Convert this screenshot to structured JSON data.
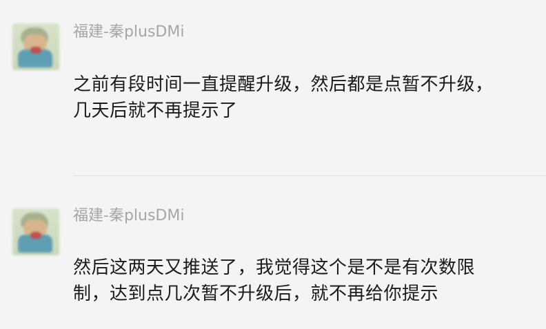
{
  "comments": [
    {
      "author": "福建-秦plusDMi",
      "text": "之前有段时间一直提醒升级，然后都是点暂不升级，几天后就不再提示了"
    },
    {
      "author": "福建-秦plusDMi",
      "text": "然后这两天又推送了，我觉得这个是不是有次数限制，达到点几次暂不升级后，就不再给你提示"
    }
  ],
  "icons": {
    "avatar": "user-avatar-icon"
  },
  "colors": {
    "background": "#f4f4f4",
    "author": "#a6a6a6",
    "text": "#1a1a1a",
    "divider": "#e3e3e3"
  }
}
